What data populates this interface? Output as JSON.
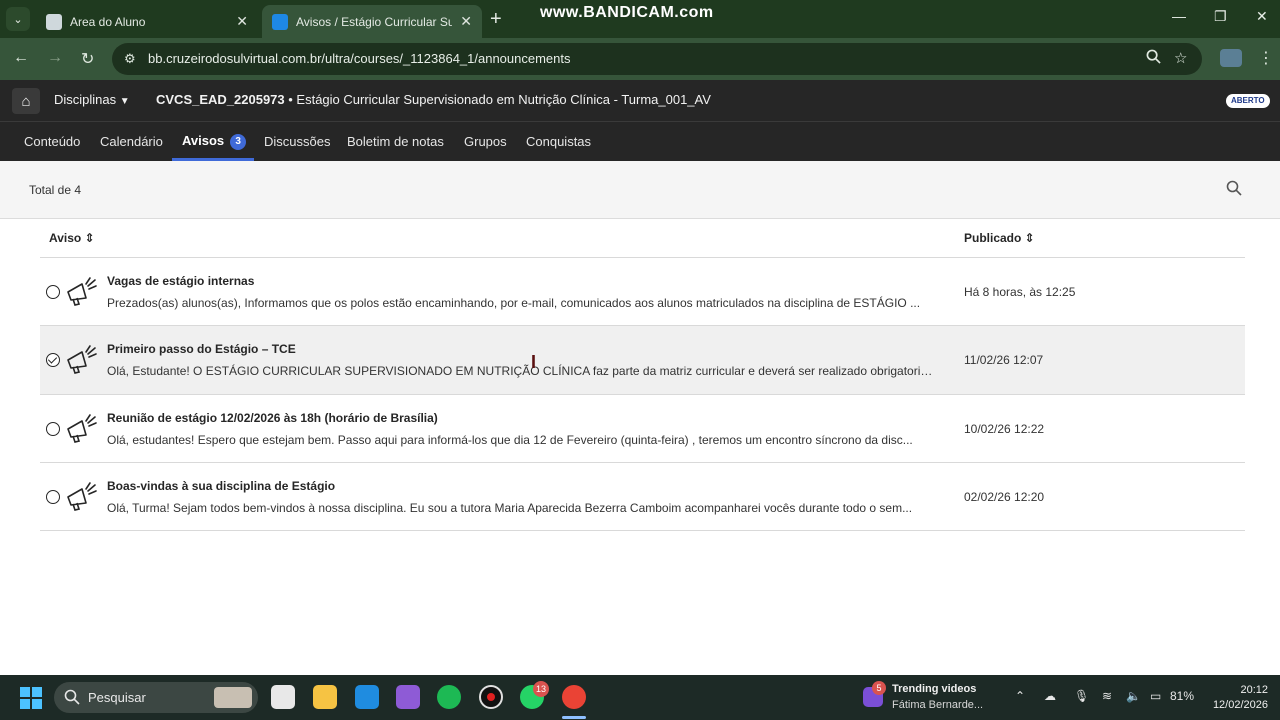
{
  "browser": {
    "tabs": [
      {
        "title": "Area do Aluno",
        "active": false
      },
      {
        "title": "Avisos / Estágio Curricular Supe",
        "active": true
      }
    ],
    "watermark": "www.BANDICAM.com",
    "url": "bb.cruzeirodosulvirtual.com.br/ultra/courses/_1123864_1/announcements"
  },
  "course": {
    "disciplinas_label": "Disciplinas",
    "code": "CVCS_EAD_2205973",
    "name": " • Estágio Curricular Supervisionado em Nutrição Clínica - Turma_001_AV",
    "status": "ABERTO"
  },
  "nav": {
    "items": [
      "Conteúdo",
      "Calendário",
      "Avisos",
      "Discussões",
      "Boletim de notas",
      "Grupos",
      "Conquistas"
    ],
    "active": "Avisos",
    "avisos_count": "3"
  },
  "list": {
    "total": "Total de 4",
    "col_aviso": "Aviso ⇕",
    "col_publicado": "Publicado ⇕",
    "rows": [
      {
        "title": "Vagas de estágio internas",
        "preview": "Prezados(as) alunos(as), Informamos que os polos estão encaminhando, por e-mail, comunicados aos alunos matriculados na disciplina de ESTÁGIO ...",
        "date": "Há 8 horas, às 12:25",
        "read": false
      },
      {
        "title": "Primeiro passo do Estágio – TCE",
        "preview": "Olá, Estudante! O ESTÁGIO CURRICULAR SUPERVISIONADO EM NUTRIÇÃO CLÍNICA faz parte da matriz curricular e deverá ser realizado obrigatoriam...",
        "date": "11/02/26 12:07",
        "read": true
      },
      {
        "title": "Reunião de estágio 12/02/2026 às 18h (horário de Brasília)",
        "preview": "Olá, estudantes! Espero que estejam bem. Passo aqui para informá-los que dia 12 de Fevereiro (quinta-feira) , teremos um encontro síncrono da disc...",
        "date": "10/02/26 12:22",
        "read": false
      },
      {
        "title": "Boas-vindas à sua disciplina de Estágio",
        "preview": "Olá, Turma! Sejam todos bem-vindos à nossa disciplina. Eu sou a tutora Maria Aparecida Bezerra Camboim acompanharei vocês durante todo o sem...",
        "date": "02/02/26 12:20",
        "read": false
      }
    ]
  },
  "taskbar": {
    "search_placeholder": "Pesquisar",
    "whatsapp_badge": "13",
    "widget_badge": "5",
    "widget_title": "Trending videos",
    "widget_sub": "Fátima Bernarde...",
    "battery": "81%",
    "time": "20:12",
    "date": "12/02/2026"
  },
  "colors": {
    "accent": "#3f6ad8",
    "browser_frame": "#1f3a1f",
    "course_bar": "#262626"
  }
}
